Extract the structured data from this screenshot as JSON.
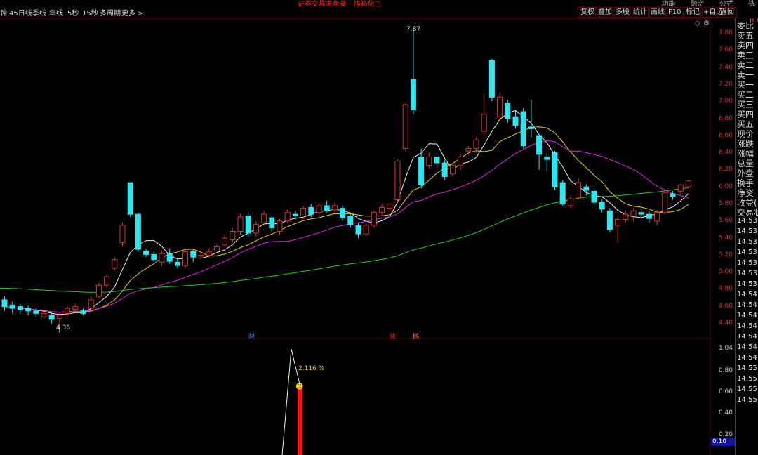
{
  "top": {
    "promo": "证券交易未盘录 · 锚箱化工",
    "menu": [
      "功能",
      "融资",
      "公式",
      "选"
    ]
  },
  "toolbar": {
    "periods": [
      "钟",
      "45日线",
      "季线",
      "年线",
      "5秒",
      "15秒",
      "多周期",
      "更多 >"
    ],
    "tools": [
      "复权",
      "叠加",
      "多股",
      "统计",
      "画线",
      "F10",
      "标记",
      "+自选",
      "返回"
    ]
  },
  "price_axis": {
    "ticks": [
      "7.80",
      "7.60",
      "7.40",
      "7.20",
      "7.00",
      "6.80",
      "6.60",
      "6.40",
      "6.20",
      "6.00",
      "5.80",
      "5.60",
      "5.40",
      "5.20",
      "5.00",
      "4.80",
      "4.60",
      "4.40"
    ],
    "indicator_ticks": [
      "1.04",
      "0.80",
      "0.60",
      "0.40",
      "0.20"
    ],
    "indicator_value": "0.10"
  },
  "quote_panel": {
    "badge": "R 00",
    "labels": [
      "委比",
      "卖五",
      "卖四",
      "卖三",
      "卖二",
      "卖一",
      "买一",
      "买二",
      "买三",
      "买四",
      "买五",
      "现价",
      "涨跌",
      "涨幅",
      "总量",
      "外盘",
      "换手",
      "净资",
      "收益(三",
      "交易状"
    ],
    "times": [
      "14:53",
      "14:53",
      "14:53",
      "14:53",
      "14:53",
      "14:53",
      "14:53",
      "14:54",
      "14:54",
      "14:54",
      "14:54",
      "14:54",
      "14:54",
      "14:54",
      "14:55",
      "14:55",
      "14:55",
      "14:55"
    ]
  },
  "annotations": {
    "high": "7.87",
    "low": "4.36",
    "indicator_pct": "2.116 %",
    "event_fin": "财",
    "event_rise": "涨",
    "event_up": "鹅"
  },
  "chart_data": {
    "type": "candlestick",
    "ylim": [
      4.3,
      7.9
    ],
    "candles": [
      [
        4.68,
        4.6,
        4.72,
        4.55
      ],
      [
        4.62,
        4.58,
        4.66,
        4.52
      ],
      [
        4.6,
        4.56,
        4.63,
        4.52
      ],
      [
        4.58,
        4.55,
        4.61,
        4.5
      ],
      [
        4.55,
        4.52,
        4.58,
        4.48
      ],
      [
        4.48,
        4.52,
        4.56,
        4.45
      ],
      [
        4.5,
        4.45,
        4.53,
        4.4
      ],
      [
        4.46,
        4.5,
        4.54,
        4.36
      ],
      [
        4.52,
        4.58,
        4.61,
        4.49
      ],
      [
        4.57,
        4.6,
        4.63,
        4.53
      ],
      [
        4.55,
        4.52,
        4.58,
        4.5
      ],
      [
        4.58,
        4.68,
        4.72,
        4.55
      ],
      [
        4.72,
        4.85,
        4.88,
        4.7
      ],
      [
        4.85,
        4.95,
        4.98,
        4.82
      ],
      [
        5.05,
        5.15,
        5.18,
        5.02
      ],
      [
        5.35,
        5.55,
        5.58,
        5.3
      ],
      [
        6.05,
        5.68,
        6.05,
        5.65
      ],
      [
        5.68,
        5.27,
        5.7,
        5.25
      ],
      [
        5.25,
        5.21,
        5.28,
        5.18
      ],
      [
        5.21,
        5.15,
        5.24,
        5.12
      ],
      [
        5.12,
        5.22,
        5.25,
        5.08
      ],
      [
        5.22,
        5.13,
        5.28,
        5.1
      ],
      [
        5.12,
        5.08,
        5.16,
        5.05
      ],
      [
        5.08,
        5.24,
        5.28,
        5.05
      ],
      [
        5.25,
        5.18,
        5.27,
        5.12
      ],
      [
        5.19,
        5.2,
        5.24,
        5.16
      ],
      [
        5.2,
        5.24,
        5.28,
        5.17
      ],
      [
        5.25,
        5.3,
        5.33,
        5.22
      ],
      [
        5.32,
        5.4,
        5.44,
        5.3
      ],
      [
        5.38,
        5.48,
        5.52,
        5.35
      ],
      [
        5.48,
        5.65,
        5.68,
        5.44
      ],
      [
        5.66,
        5.46,
        5.7,
        5.42
      ],
      [
        5.46,
        5.56,
        5.6,
        5.42
      ],
      [
        5.58,
        5.68,
        5.72,
        5.55
      ],
      [
        5.64,
        5.52,
        5.67,
        5.48
      ],
      [
        5.48,
        5.6,
        5.63,
        5.44
      ],
      [
        5.6,
        5.7,
        5.74,
        5.57
      ],
      [
        5.68,
        5.66,
        5.72,
        5.62
      ],
      [
        5.66,
        5.75,
        5.78,
        5.62
      ],
      [
        5.76,
        5.68,
        5.8,
        5.65
      ],
      [
        5.7,
        5.78,
        5.82,
        5.68
      ],
      [
        5.78,
        5.72,
        5.84,
        5.7
      ],
      [
        5.73,
        5.78,
        5.81,
        5.7
      ],
      [
        5.75,
        5.64,
        5.78,
        5.6
      ],
      [
        5.66,
        5.56,
        5.7,
        5.52
      ],
      [
        5.55,
        5.45,
        5.58,
        5.4
      ],
      [
        5.45,
        5.55,
        5.58,
        5.42
      ],
      [
        5.55,
        5.7,
        5.72,
        5.52
      ],
      [
        5.7,
        5.76,
        5.8,
        5.66
      ],
      [
        5.75,
        5.8,
        5.82,
        5.7
      ],
      [
        5.85,
        6.3,
        6.32,
        5.82
      ],
      [
        6.45,
        6.96,
        6.98,
        6.42
      ],
      [
        7.26,
        6.9,
        7.87,
        6.85
      ],
      [
        6.35,
        6.02,
        6.45,
        5.98
      ],
      [
        6.25,
        6.35,
        6.4,
        6.22
      ],
      [
        6.35,
        6.28,
        6.38,
        6.22
      ],
      [
        6.28,
        6.12,
        6.32,
        6.08
      ],
      [
        6.15,
        6.25,
        6.28,
        6.12
      ],
      [
        6.25,
        6.35,
        6.38,
        6.2
      ],
      [
        6.42,
        6.45,
        6.48,
        6.38
      ],
      [
        6.45,
        6.55,
        6.58,
        6.4
      ],
      [
        6.65,
        6.85,
        7.1,
        6.6
      ],
      [
        7.48,
        7.05,
        7.5,
        7.0
      ],
      [
        6.82,
        7.05,
        7.1,
        6.78
      ],
      [
        6.98,
        6.8,
        7.02,
        6.75
      ],
      [
        6.82,
        6.72,
        6.9,
        6.68
      ],
      [
        6.88,
        6.48,
        6.92,
        6.45
      ],
      [
        6.7,
        6.68,
        7.02,
        6.58
      ],
      [
        6.6,
        6.38,
        6.62,
        6.2
      ],
      [
        6.35,
        6.32,
        6.4,
        6.18
      ],
      [
        6.4,
        6.0,
        6.42,
        5.96
      ],
      [
        6.05,
        5.8,
        6.08,
        5.78
      ],
      [
        5.78,
        5.86,
        5.9,
        5.76
      ],
      [
        5.88,
        6.05,
        6.1,
        5.85
      ],
      [
        6.0,
        5.96,
        6.03,
        5.9
      ],
      [
        5.95,
        5.82,
        5.98,
        5.8
      ],
      [
        5.82,
        5.74,
        5.85,
        5.7
      ],
      [
        5.72,
        5.5,
        5.75,
        5.47
      ],
      [
        5.55,
        5.62,
        5.65,
        5.35
      ],
      [
        5.62,
        5.68,
        5.72,
        5.58
      ],
      [
        5.66,
        5.72,
        5.75,
        5.6
      ],
      [
        5.7,
        5.68,
        5.74,
        5.64
      ],
      [
        5.68,
        5.63,
        5.72,
        5.58
      ],
      [
        5.6,
        5.7,
        5.73,
        5.55
      ],
      [
        5.7,
        5.93,
        5.95,
        5.68
      ],
      [
        5.92,
        5.89,
        5.95,
        5.85
      ],
      [
        5.95,
        6.02,
        6.04,
        5.92
      ],
      [
        6.0,
        6.07,
        6.08,
        5.98
      ]
    ],
    "indicator": {
      "pct_label": "2.116 %",
      "bar_value": 0.6
    }
  }
}
